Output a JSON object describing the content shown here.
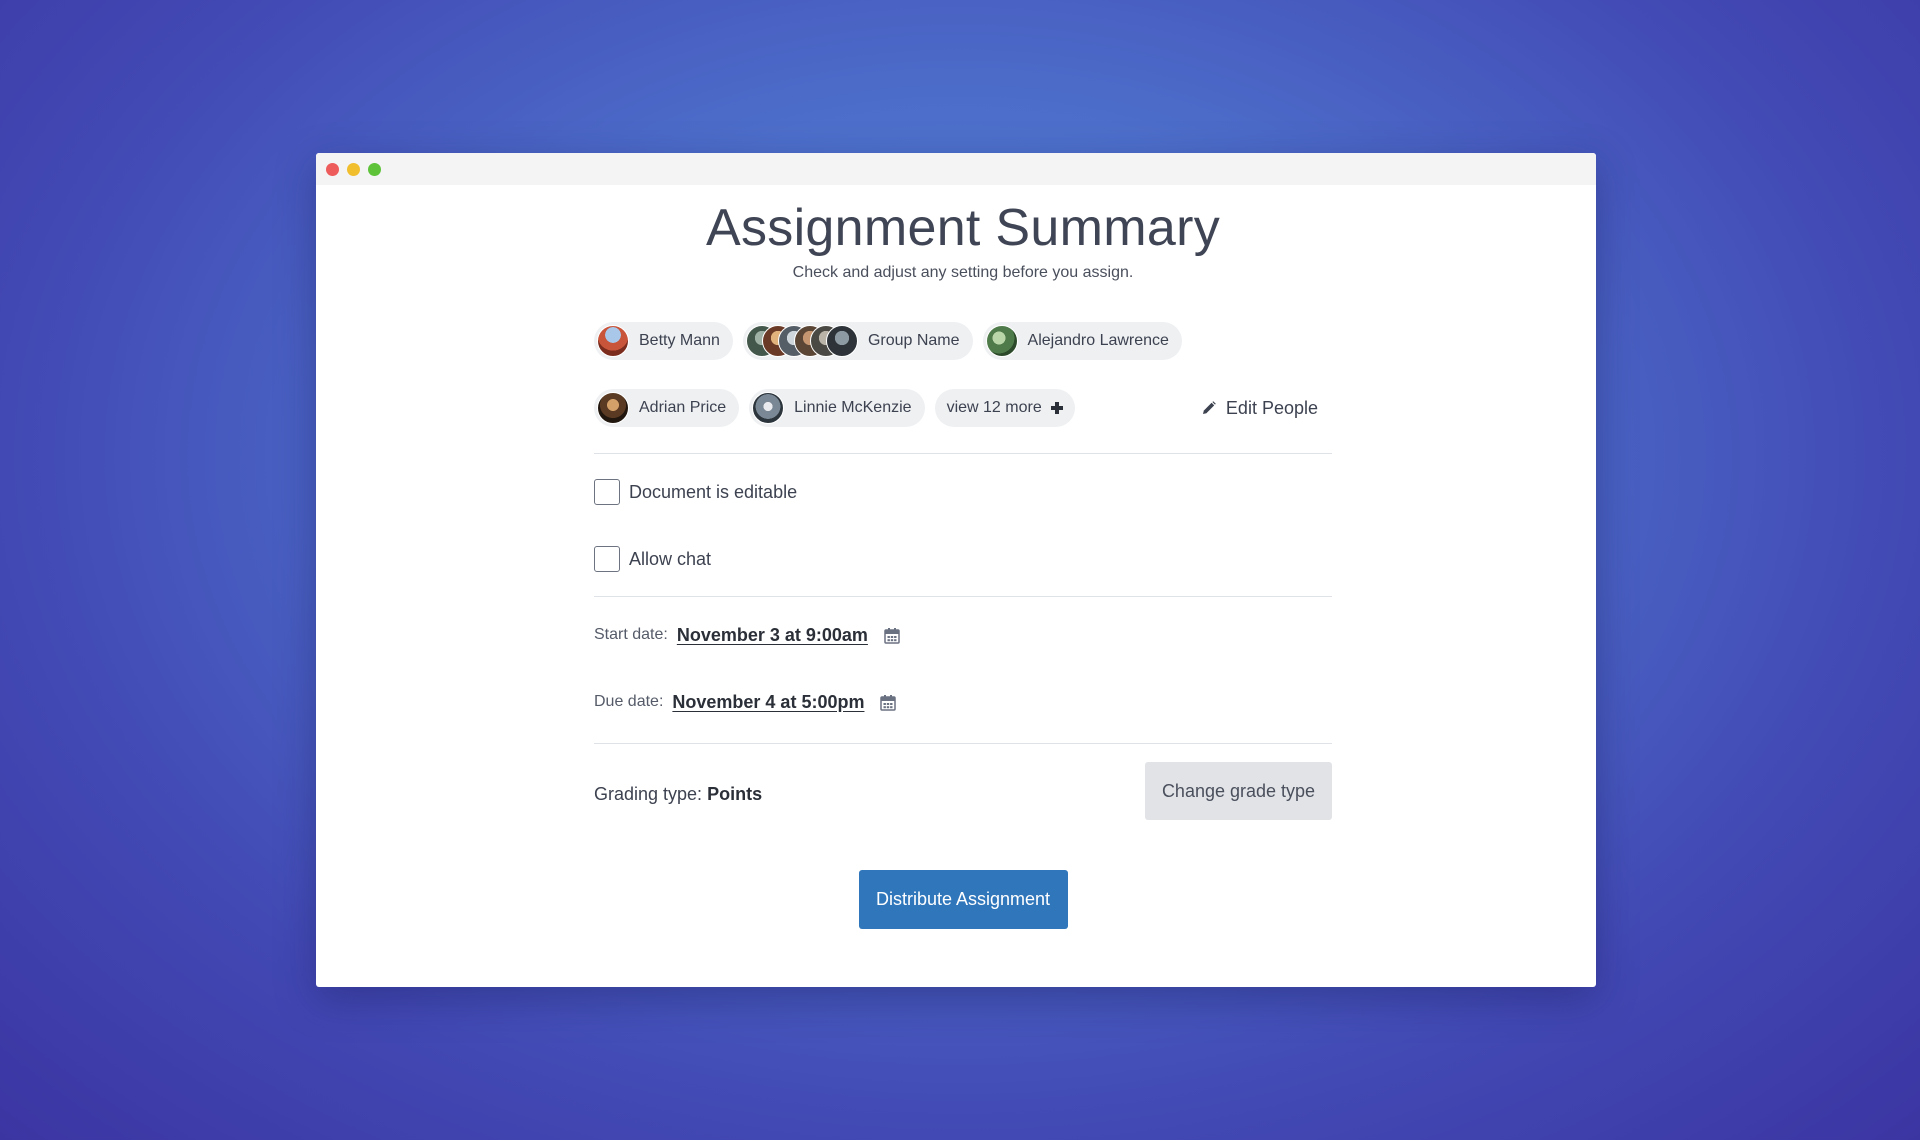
{
  "header": {
    "title": "Assignment Summary",
    "subtitle": "Check and adjust any setting before you assign."
  },
  "people": {
    "row1": [
      {
        "name": "Betty Mann",
        "avatar": "photo-avatar"
      },
      {
        "name": "Group Name",
        "avatar": "group-avatars"
      },
      {
        "name": "Alejandro Lawrence",
        "avatar": "photo-avatar"
      }
    ],
    "row2": [
      {
        "name": "Adrian Price",
        "avatar": "photo-avatar"
      },
      {
        "name": "Linnie McKenzie",
        "avatar": "photo-avatar"
      }
    ],
    "view_more_label": "view 12 more",
    "view_more_icon": "plus-icon",
    "edit_label": "Edit People",
    "edit_icon": "pencil-icon"
  },
  "options": {
    "document_editable": {
      "label": "Document is editable",
      "checked": false
    },
    "allow_chat": {
      "label": "Allow chat",
      "checked": false
    }
  },
  "dates": {
    "start": {
      "label": "Start date:",
      "value": "November 3 at 9:00am",
      "icon": "calendar-icon"
    },
    "due": {
      "label": "Due date:",
      "value": "November 4 at 5:00pm",
      "icon": "calendar-icon"
    }
  },
  "grading": {
    "label": "Grading type:",
    "value": "Points",
    "change_button_label": "Change grade type"
  },
  "actions": {
    "distribute_label": "Distribute Assignment"
  },
  "colors": {
    "primary_button": "#2f76bb",
    "secondary_button": "#e1e3e7",
    "window_close": "#ee5b5b",
    "window_minimize": "#f1be2d",
    "window_maximize": "#5fc33a"
  }
}
